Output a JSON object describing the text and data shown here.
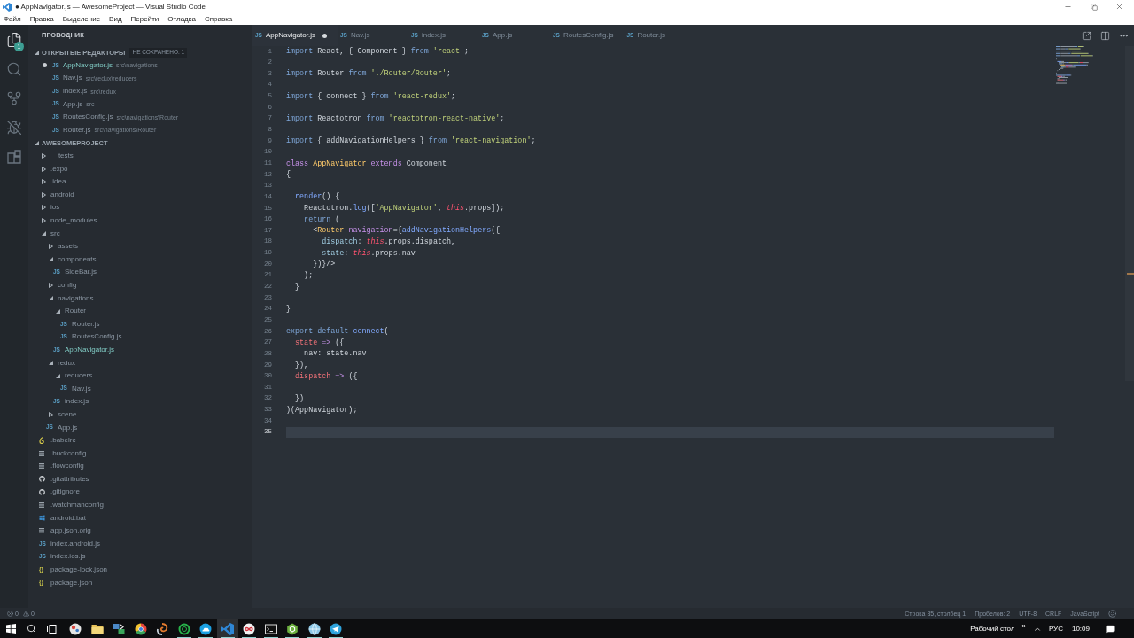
{
  "window": {
    "title": "● AppNavigator.js — AwesomeProject — Visual Studio Code"
  },
  "menu": [
    "Файл",
    "Правка",
    "Выделение",
    "Вид",
    "Перейти",
    "Отладка",
    "Справка"
  ],
  "activity_bar": {
    "items": [
      {
        "selected": true,
        "badge": "1"
      },
      {
        "selected": false
      },
      {
        "selected": false
      },
      {
        "selected": false
      },
      {
        "selected": false
      }
    ]
  },
  "sidebar": {
    "title": "ПРОВОДНИК",
    "open_editors": {
      "title": "ОТКРЫТЫЕ РЕДАКТОРЫ",
      "expanded": true,
      "badge": "НЕ СОХРАНЕНО: 1",
      "items": [
        {
          "glyph": "JS",
          "name": "AppNavigator.js",
          "path": "src\\navigations",
          "selected": true,
          "modified": true
        },
        {
          "glyph": "JS",
          "name": "Nav.js",
          "path": "src\\redux\\reducers",
          "selected": false,
          "modified": false
        },
        {
          "glyph": "JS",
          "name": "index.js",
          "path": "src\\redux",
          "selected": false,
          "modified": false
        },
        {
          "glyph": "JS",
          "name": "App.js",
          "path": "src",
          "selected": false,
          "modified": false
        },
        {
          "glyph": "JS",
          "name": "RoutesConfig.js",
          "path": "src\\navigations\\Router",
          "selected": false,
          "modified": false
        },
        {
          "glyph": "JS",
          "name": "Router.js",
          "path": "src\\navigations\\Router",
          "selected": false,
          "modified": false
        }
      ]
    },
    "project": {
      "title": "AWESOMEPROJECT",
      "expanded": true,
      "tree": [
        {
          "name": "__tests__",
          "kind": "folder",
          "expanded": false,
          "selected": false
        },
        {
          "name": ".expo",
          "kind": "folder",
          "expanded": false,
          "selected": false
        },
        {
          "name": ".idea",
          "kind": "folder",
          "expanded": false,
          "selected": false
        },
        {
          "name": "android",
          "kind": "folder",
          "expanded": false,
          "selected": false
        },
        {
          "name": "ios",
          "kind": "folder",
          "expanded": false,
          "selected": false
        },
        {
          "name": "node_modules",
          "kind": "folder",
          "expanded": false,
          "selected": false
        },
        {
          "name": "src",
          "kind": "folder",
          "expanded": true,
          "selected": false,
          "children": [
            {
              "name": "assets",
              "kind": "folder",
              "expanded": false,
              "selected": false
            },
            {
              "name": "components",
              "kind": "folder",
              "expanded": true,
              "selected": false,
              "children": [
                {
                  "name": "SideBar.js",
                  "kind": "js",
                  "glyph": "JS",
                  "selected": false
                }
              ]
            },
            {
              "name": "config",
              "kind": "folder",
              "expanded": false,
              "selected": false
            },
            {
              "name": "navigations",
              "kind": "folder",
              "expanded": true,
              "selected": false,
              "children": [
                {
                  "name": "Router",
                  "kind": "folder",
                  "expanded": true,
                  "selected": false,
                  "children": [
                    {
                      "name": "Router.js",
                      "kind": "js",
                      "glyph": "JS",
                      "selected": false
                    },
                    {
                      "name": "RoutesConfig.js",
                      "kind": "js",
                      "glyph": "JS",
                      "selected": false
                    }
                  ]
                },
                {
                  "name": "AppNavigator.js",
                  "kind": "js",
                  "glyph": "JS",
                  "selected": true
                }
              ]
            },
            {
              "name": "redux",
              "kind": "folder",
              "expanded": true,
              "selected": false,
              "children": [
                {
                  "name": "reducers",
                  "kind": "folder",
                  "expanded": true,
                  "selected": false,
                  "children": [
                    {
                      "name": "Nav.js",
                      "kind": "js",
                      "glyph": "JS",
                      "selected": false
                    }
                  ]
                },
                {
                  "name": "index.js",
                  "kind": "js",
                  "glyph": "JS",
                  "selected": false
                }
              ]
            },
            {
              "name": "scene",
              "kind": "folder",
              "expanded": false,
              "selected": false
            },
            {
              "name": "App.js",
              "kind": "js",
              "glyph": "JS",
              "selected": false
            }
          ]
        },
        {
          "name": ".babelrc",
          "kind": "babel",
          "selected": false
        },
        {
          "name": ".buckconfig",
          "kind": "text",
          "selected": false
        },
        {
          "name": ".flowconfig",
          "kind": "text",
          "selected": false
        },
        {
          "name": ".gitattributes",
          "kind": "git",
          "selected": false
        },
        {
          "name": ".gitignore",
          "kind": "git",
          "selected": false
        },
        {
          "name": ".watchmanconfig",
          "kind": "text",
          "selected": false
        },
        {
          "name": "android.bat",
          "kind": "windows",
          "selected": false
        },
        {
          "name": "app.json.orig",
          "kind": "text",
          "selected": false
        },
        {
          "name": "index.android.js",
          "kind": "js",
          "glyph": "JS",
          "selected": false
        },
        {
          "name": "index.ios.js",
          "kind": "js",
          "glyph": "JS",
          "selected": false
        },
        {
          "name": "package-lock.json",
          "kind": "json",
          "glyph": "{}",
          "selected": false
        },
        {
          "name": "package.json",
          "kind": "json",
          "glyph": "{}",
          "selected": false
        }
      ]
    }
  },
  "tabs": [
    {
      "glyph": "JS",
      "name": "AppNavigator.js",
      "selected": true,
      "modified": true
    },
    {
      "glyph": "JS",
      "name": "Nav.js",
      "selected": false,
      "modified": false
    },
    {
      "glyph": "JS",
      "name": "index.js",
      "selected": false,
      "modified": false
    },
    {
      "glyph": "JS",
      "name": "App.js",
      "selected": false,
      "modified": false
    },
    {
      "glyph": "JS",
      "name": "RoutesConfig.js",
      "selected": false,
      "modified": false
    },
    {
      "glyph": "JS",
      "name": "Router.js",
      "selected": false,
      "modified": false
    }
  ],
  "editor": {
    "lines": [
      {
        "number": "1",
        "current": false,
        "tokens": [
          {
            "text": "import",
            "kind": "keyword"
          },
          {
            "text": " React, { Component } ",
            "kind": "plain"
          },
          {
            "text": "from",
            "kind": "keyword"
          },
          {
            "text": " 'react'",
            "kind": "string"
          },
          {
            "text": ";",
            "kind": "plain"
          }
        ]
      },
      {
        "number": "2",
        "current": false
      },
      {
        "number": "3",
        "current": false,
        "tokens": [
          {
            "text": "import",
            "kind": "keyword"
          },
          {
            "text": " Router ",
            "kind": "plain"
          },
          {
            "text": "from",
            "kind": "keyword"
          },
          {
            "text": " './Router/Router'",
            "kind": "string"
          },
          {
            "text": ";",
            "kind": "plain"
          }
        ]
      },
      {
        "number": "4",
        "current": false
      },
      {
        "number": "5",
        "current": false,
        "tokens": [
          {
            "text": "import",
            "kind": "keyword"
          },
          {
            "text": " { connect } ",
            "kind": "plain"
          },
          {
            "text": "from",
            "kind": "keyword"
          },
          {
            "text": " 'react-redux'",
            "kind": "string"
          },
          {
            "text": ";",
            "kind": "plain"
          }
        ]
      },
      {
        "number": "6",
        "current": false
      },
      {
        "number": "7",
        "current": false,
        "tokens": [
          {
            "text": "import",
            "kind": "keyword"
          },
          {
            "text": " Reactotron ",
            "kind": "plain"
          },
          {
            "text": "from",
            "kind": "keyword"
          },
          {
            "text": " 'reactotron-react-native'",
            "kind": "string"
          },
          {
            "text": ";",
            "kind": "plain"
          }
        ]
      },
      {
        "number": "8",
        "current": false
      },
      {
        "number": "9",
        "current": false,
        "tokens": [
          {
            "text": "import",
            "kind": "keyword"
          },
          {
            "text": " { addNavigationHelpers } ",
            "kind": "plain"
          },
          {
            "text": "from",
            "kind": "keyword"
          },
          {
            "text": " 'react-navigation'",
            "kind": "string"
          },
          {
            "text": ";",
            "kind": "plain"
          }
        ]
      },
      {
        "number": "10",
        "current": false
      },
      {
        "number": "11",
        "current": false,
        "tokens": [
          {
            "text": "class",
            "kind": "storage"
          },
          {
            "text": " AppNavigator ",
            "kind": "class"
          },
          {
            "text": "extends",
            "kind": "storage"
          },
          {
            "text": " Component",
            "kind": "plain"
          }
        ]
      },
      {
        "number": "12",
        "current": false,
        "tokens": [
          {
            "text": "{",
            "kind": "plain"
          }
        ]
      },
      {
        "number": "13",
        "current": false
      },
      {
        "number": "14",
        "current": false,
        "tokens": [
          {
            "text": "  render",
            "kind": "function"
          },
          {
            "text": "() {",
            "kind": "plain"
          }
        ]
      },
      {
        "number": "15",
        "current": false,
        "tokens": [
          {
            "text": "    Reactotron.",
            "kind": "plain"
          },
          {
            "text": "log",
            "kind": "function"
          },
          {
            "text": "([",
            "kind": "plain"
          },
          {
            "text": "'AppNavigator'",
            "kind": "string"
          },
          {
            "text": ", ",
            "kind": "plain"
          },
          {
            "text": "this",
            "kind": "this"
          },
          {
            "text": ".props]);",
            "kind": "plain"
          }
        ]
      },
      {
        "number": "16",
        "current": false,
        "tokens": [
          {
            "text": "    return",
            "kind": "keyword"
          },
          {
            "text": " (",
            "kind": "plain"
          }
        ]
      },
      {
        "number": "17",
        "current": false,
        "tokens": [
          {
            "text": "      <",
            "kind": "plain"
          },
          {
            "text": "Router ",
            "kind": "class"
          },
          {
            "text": "navigation",
            "kind": "attr"
          },
          {
            "text": "={",
            "kind": "plain"
          },
          {
            "text": "addNavigationHelpers",
            "kind": "function"
          },
          {
            "text": "({",
            "kind": "plain"
          }
        ]
      },
      {
        "number": "18",
        "current": false,
        "tokens": [
          {
            "text": "        dispatch",
            "kind": "prop"
          },
          {
            "text": ": ",
            "kind": "plain"
          },
          {
            "text": "this",
            "kind": "this"
          },
          {
            "text": ".props.dispatch,",
            "kind": "plain"
          }
        ]
      },
      {
        "number": "19",
        "current": false,
        "tokens": [
          {
            "text": "        state",
            "kind": "prop"
          },
          {
            "text": ": ",
            "kind": "plain"
          },
          {
            "text": "this",
            "kind": "this"
          },
          {
            "text": ".props.nav",
            "kind": "plain"
          }
        ]
      },
      {
        "number": "20",
        "current": false,
        "tokens": [
          {
            "text": "      })}/>",
            "kind": "plain"
          }
        ]
      },
      {
        "number": "21",
        "current": false,
        "tokens": [
          {
            "text": "    );",
            "kind": "plain"
          }
        ]
      },
      {
        "number": "22",
        "current": false,
        "tokens": [
          {
            "text": "  }",
            "kind": "plain"
          }
        ]
      },
      {
        "number": "23",
        "current": false
      },
      {
        "number": "24",
        "current": false,
        "tokens": [
          {
            "text": "}",
            "kind": "plain"
          }
        ]
      },
      {
        "number": "25",
        "current": false
      },
      {
        "number": "26",
        "current": false,
        "tokens": [
          {
            "text": "export default ",
            "kind": "keyword"
          },
          {
            "text": "connect",
            "kind": "function"
          },
          {
            "text": "(",
            "kind": "plain"
          }
        ]
      },
      {
        "number": "27",
        "current": false,
        "tokens": [
          {
            "text": "  state ",
            "kind": "param"
          },
          {
            "text": "=>",
            "kind": "storage"
          },
          {
            "text": " ({",
            "kind": "plain"
          }
        ]
      },
      {
        "number": "28",
        "current": false,
        "tokens": [
          {
            "text": "    nav: state.nav",
            "kind": "plain"
          }
        ]
      },
      {
        "number": "29",
        "current": false,
        "tokens": [
          {
            "text": "  }),",
            "kind": "plain"
          }
        ]
      },
      {
        "number": "30",
        "current": false,
        "tokens": [
          {
            "text": "  dispatch ",
            "kind": "param"
          },
          {
            "text": "=>",
            "kind": "storage"
          },
          {
            "text": " ({",
            "kind": "plain"
          }
        ]
      },
      {
        "number": "31",
        "current": false
      },
      {
        "number": "32",
        "current": false,
        "tokens": [
          {
            "text": "  })",
            "kind": "plain"
          }
        ]
      },
      {
        "number": "33",
        "current": false,
        "tokens": [
          {
            "text": ")(AppNavigator);",
            "kind": "plain"
          }
        ]
      },
      {
        "number": "34",
        "current": false
      },
      {
        "number": "35",
        "current": true
      }
    ]
  },
  "status_bar": {
    "problems": [
      {
        "kind": "error",
        "count": "0"
      },
      {
        "kind": "warning",
        "count": "0"
      }
    ],
    "items": [
      "Строка 35, столбец 1",
      "Пробелов: 2",
      "UTF-8",
      "CRLF",
      "JavaScript"
    ]
  },
  "taskbar": {
    "apps": [
      {
        "running": false,
        "active": false
      },
      {
        "running": false,
        "active": false
      },
      {
        "running": false,
        "active": false
      },
      {
        "running": false,
        "active": false
      },
      {
        "running": false,
        "active": false
      },
      {
        "running": true,
        "active": false
      },
      {
        "running": true,
        "active": false
      },
      {
        "running": true,
        "active": true
      },
      {
        "running": true,
        "active": false
      },
      {
        "running": true,
        "active": false
      },
      {
        "running": true,
        "active": false
      },
      {
        "running": true,
        "active": false
      },
      {
        "running": true,
        "active": false
      }
    ],
    "tray": {
      "desktop": "Рабочий стол",
      "overflow": "»",
      "language": "РУС",
      "time": "10:09"
    }
  }
}
